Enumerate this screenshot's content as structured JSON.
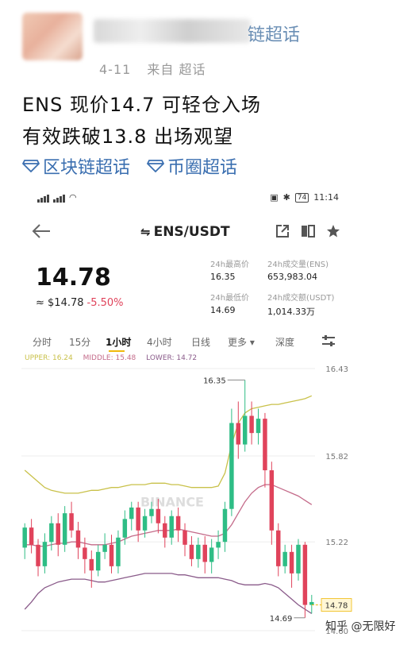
{
  "post": {
    "username_tail": "链超话",
    "date": "4-11",
    "source": "来自 超话",
    "line1": "ENS 现价14.7 可轻仓入场",
    "line2": "有效跌破13.8 出场观望",
    "topics": [
      "区块链超话",
      "币圈超话"
    ]
  },
  "status_bar": {
    "battery": "74",
    "time": "11:14"
  },
  "header": {
    "pair": "ENS/USDT"
  },
  "ticker": {
    "price": "14.78",
    "fiat": "≈ $14.78",
    "change": "-5.50%",
    "high_label": "24h最高价",
    "high": "16.35",
    "low_label": "24h最低价",
    "low": "14.69",
    "vol_ens_label": "24h成交量(ENS)",
    "vol_ens": "653,983.04",
    "vol_usdt_label": "24h成交额(USDT)",
    "vol_usdt": "1,014.33万"
  },
  "tabs": [
    "分时",
    "15分",
    "1小时",
    "4小时",
    "日线",
    "更多",
    "深度"
  ],
  "active_tab": "1小时",
  "bollinger": {
    "upper_label": "UPPER: 16.24",
    "middle_label": "MIDDLE: 15.48",
    "lower_label": "LOWER: 14.72"
  },
  "colors": {
    "up": "#2ebd85",
    "down": "#e0435b",
    "upper": "#c9c14a",
    "middle": "#c46b8a",
    "lower": "#8a5b8a",
    "link": "#3b6fb0",
    "accent": "#f0b90b"
  },
  "chart_data": {
    "type": "candlestick",
    "y_ticks": [
      "16.43",
      "15.82",
      "15.22",
      "14.60"
    ],
    "ylim": [
      14.6,
      16.43
    ],
    "last_price_label": "14.78",
    "max_label": "16.35",
    "min_label": "14.69",
    "watermark": "BINANCE",
    "candles": [
      [
        15.18,
        15.32,
        15.1,
        15.35
      ],
      [
        15.32,
        15.2,
        15.14,
        15.38
      ],
      [
        15.2,
        15.05,
        14.98,
        15.24
      ],
      [
        15.05,
        15.22,
        15.0,
        15.28
      ],
      [
        15.22,
        15.35,
        15.16,
        15.4
      ],
      [
        15.35,
        15.2,
        15.12,
        15.42
      ],
      [
        15.2,
        15.42,
        15.15,
        15.47
      ],
      [
        15.42,
        15.3,
        15.25,
        15.5
      ],
      [
        15.3,
        15.18,
        15.1,
        15.36
      ],
      [
        15.18,
        15.1,
        15.0,
        15.25
      ],
      [
        15.1,
        15.02,
        14.9,
        15.16
      ],
      [
        15.02,
        15.15,
        14.98,
        15.2
      ],
      [
        15.15,
        15.2,
        15.1,
        15.28
      ],
      [
        15.2,
        15.05,
        15.0,
        15.27
      ],
      [
        15.05,
        15.25,
        15.0,
        15.3
      ],
      [
        15.25,
        15.38,
        15.2,
        15.44
      ],
      [
        15.38,
        15.46,
        15.3,
        15.5
      ],
      [
        15.46,
        15.3,
        15.22,
        15.5
      ],
      [
        15.3,
        15.4,
        15.25,
        15.45
      ],
      [
        15.4,
        15.45,
        15.35,
        15.5
      ],
      [
        15.45,
        15.35,
        15.28,
        15.52
      ],
      [
        15.35,
        15.25,
        15.18,
        15.4
      ],
      [
        15.25,
        15.4,
        15.2,
        15.44
      ],
      [
        15.4,
        15.3,
        15.22,
        15.46
      ],
      [
        15.3,
        15.2,
        15.12,
        15.35
      ],
      [
        15.2,
        15.1,
        15.05,
        15.26
      ],
      [
        15.1,
        15.2,
        15.04,
        15.25
      ],
      [
        15.2,
        15.08,
        15.0,
        15.26
      ],
      [
        15.08,
        15.18,
        15.0,
        15.24
      ],
      [
        15.18,
        15.22,
        15.1,
        15.3
      ],
      [
        15.22,
        15.45,
        15.15,
        15.5
      ],
      [
        15.45,
        16.05,
        15.4,
        16.15
      ],
      [
        16.05,
        15.9,
        15.8,
        16.2
      ],
      [
        15.9,
        16.1,
        15.85,
        16.35
      ],
      [
        16.1,
        15.98,
        15.9,
        16.2
      ],
      [
        15.98,
        16.08,
        15.9,
        16.15
      ],
      [
        16.08,
        15.72,
        15.6,
        16.12
      ],
      [
        15.72,
        15.3,
        15.2,
        15.78
      ],
      [
        15.3,
        15.05,
        14.98,
        15.35
      ],
      [
        15.05,
        15.15,
        15.0,
        15.2
      ],
      [
        15.15,
        15.0,
        14.9,
        15.2
      ],
      [
        15.0,
        15.2,
        14.95,
        15.24
      ],
      [
        15.2,
        14.78,
        14.69,
        15.22
      ],
      [
        14.78,
        14.8,
        14.72,
        14.85
      ]
    ],
    "upper_band": [
      15.72,
      15.68,
      15.64,
      15.6,
      15.58,
      15.57,
      15.56,
      15.56,
      15.56,
      15.57,
      15.58,
      15.58,
      15.59,
      15.6,
      15.6,
      15.61,
      15.62,
      15.62,
      15.62,
      15.63,
      15.63,
      15.63,
      15.62,
      15.62,
      15.61,
      15.6,
      15.6,
      15.6,
      15.6,
      15.61,
      15.7,
      15.9,
      16.05,
      16.12,
      16.15,
      16.16,
      16.17,
      16.18,
      16.18,
      16.19,
      16.2,
      16.21,
      16.22,
      16.24
    ],
    "middle_band": [
      15.2,
      15.2,
      15.19,
      15.19,
      15.2,
      15.21,
      15.21,
      15.22,
      15.22,
      15.21,
      15.2,
      15.2,
      15.2,
      15.21,
      15.22,
      15.24,
      15.26,
      15.27,
      15.28,
      15.29,
      15.3,
      15.3,
      15.3,
      15.31,
      15.3,
      15.29,
      15.28,
      15.27,
      15.26,
      15.26,
      15.28,
      15.34,
      15.42,
      15.5,
      15.56,
      15.6,
      15.62,
      15.62,
      15.6,
      15.58,
      15.56,
      15.54,
      15.51,
      15.48
    ],
    "lower_band": [
      14.75,
      14.8,
      14.86,
      14.9,
      14.92,
      14.94,
      14.95,
      14.96,
      14.96,
      14.96,
      14.95,
      14.94,
      14.94,
      14.95,
      14.96,
      14.97,
      14.98,
      14.99,
      15.0,
      15.0,
      15.0,
      15.0,
      15.0,
      14.99,
      14.99,
      14.98,
      14.97,
      14.97,
      14.97,
      14.97,
      14.96,
      14.95,
      14.93,
      14.92,
      14.92,
      14.92,
      14.93,
      14.92,
      14.9,
      14.86,
      14.82,
      14.78,
      14.75,
      14.72
    ]
  },
  "watermark": "知乎 @无限好"
}
